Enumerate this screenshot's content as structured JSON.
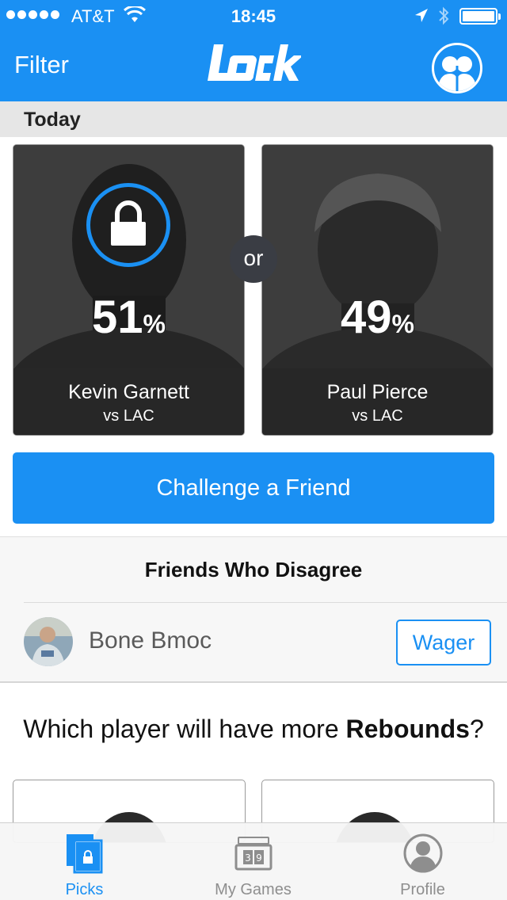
{
  "status_bar": {
    "carrier": "AT&T",
    "time": "18:45"
  },
  "nav": {
    "filter_label": "Filter",
    "logo_text": "lock"
  },
  "section": {
    "title": "Today"
  },
  "matchup": {
    "or_label": "or",
    "players": [
      {
        "name": "Kevin Garnett",
        "opponent": "vs LAC",
        "percent": "51",
        "percent_sign": "%",
        "locked": true
      },
      {
        "name": "Paul Pierce",
        "opponent": "vs LAC",
        "percent": "49",
        "percent_sign": "%",
        "locked": false
      }
    ]
  },
  "challenge_button": "Challenge a Friend",
  "disagree": {
    "title": "Friends Who Disagree",
    "friends": [
      {
        "name": "Bone Bmoc",
        "action": "Wager"
      }
    ]
  },
  "next_question": {
    "prefix": "Which player will have more ",
    "stat": "Rebounds",
    "suffix": "?"
  },
  "tabs": [
    {
      "label": "Picks",
      "active": true
    },
    {
      "label": "My Games",
      "active": false
    },
    {
      "label": "Profile",
      "active": false
    }
  ],
  "colors": {
    "accent": "#1a90f3",
    "card_bg": "#2e2e2e",
    "tab_inactive": "#8e8e8e"
  }
}
